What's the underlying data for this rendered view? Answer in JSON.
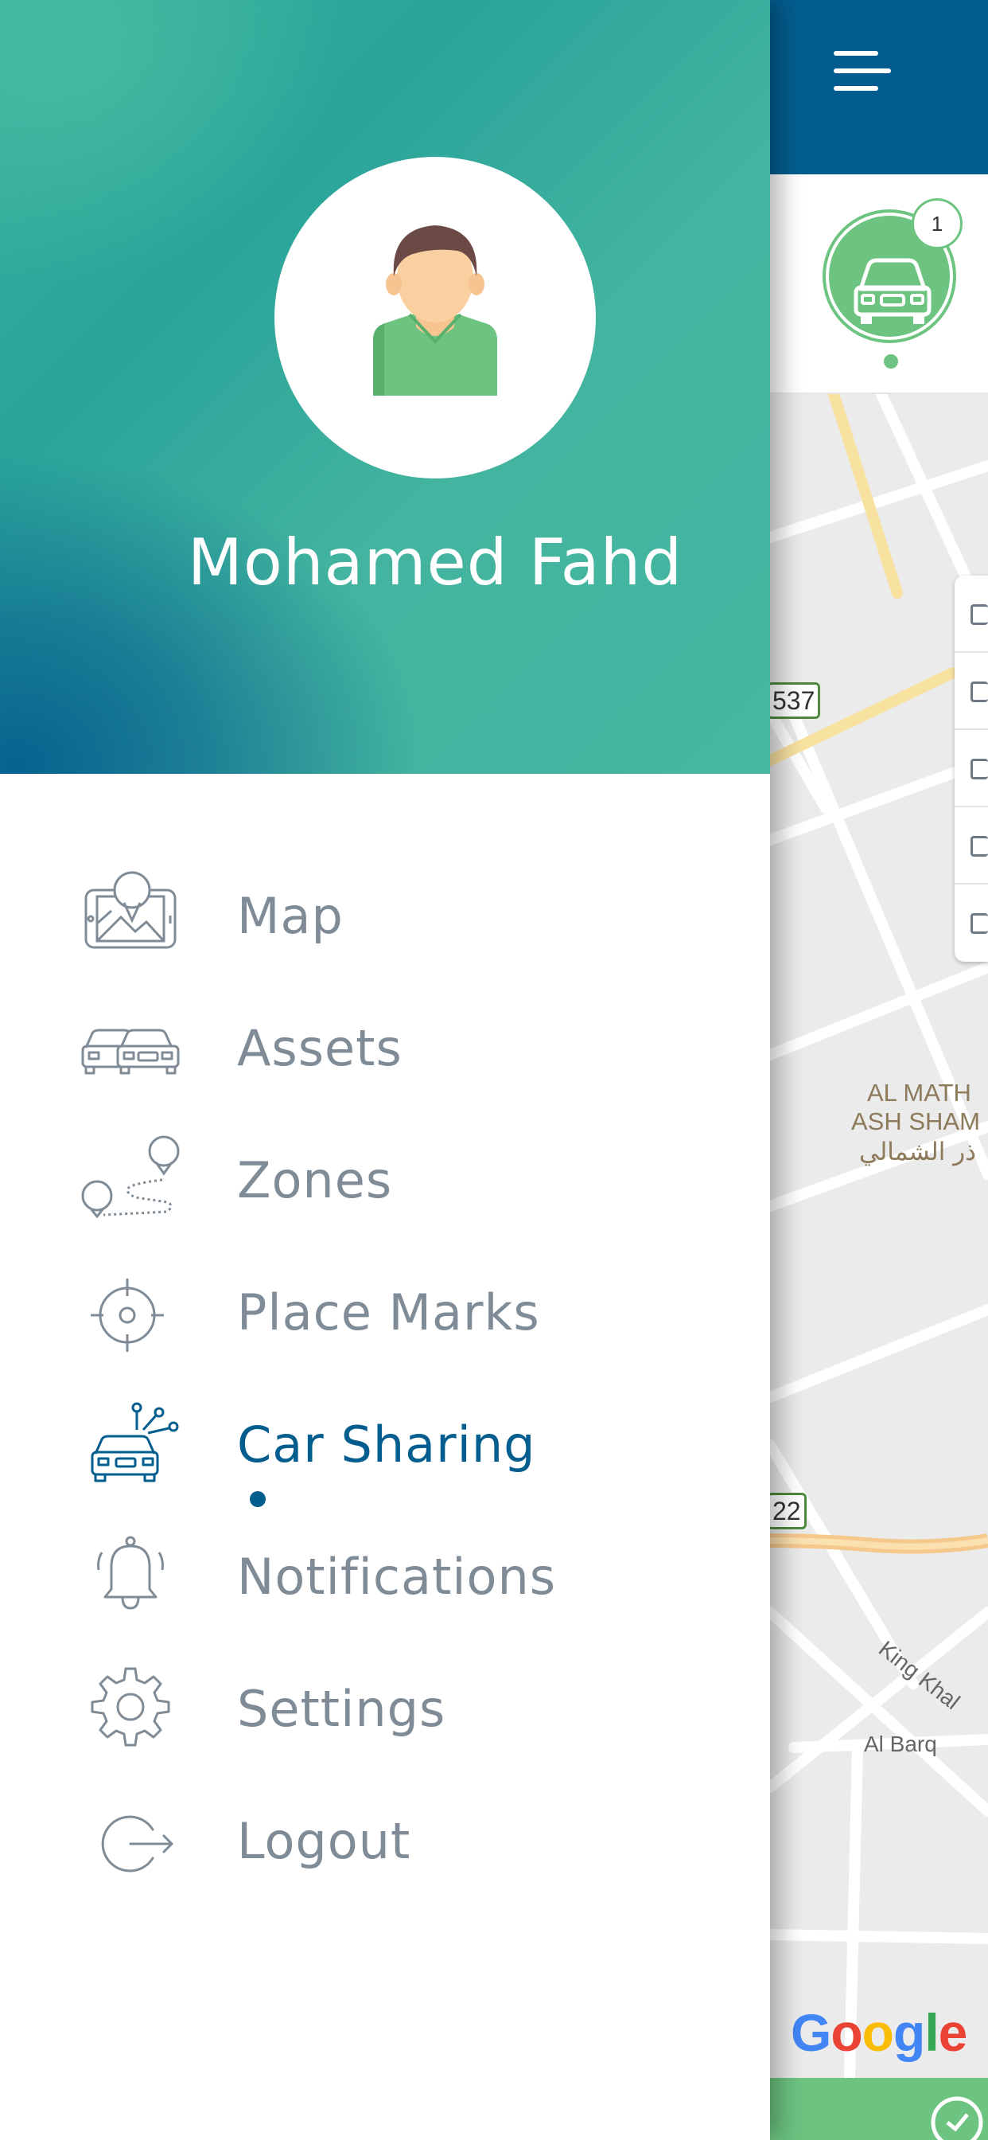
{
  "user": {
    "name": "Mohamed Fahd"
  },
  "menu": {
    "items": [
      {
        "id": "map",
        "label": "Map",
        "icon": "map-icon"
      },
      {
        "id": "assets",
        "label": "Assets",
        "icon": "cars-icon"
      },
      {
        "id": "zones",
        "label": "Zones",
        "icon": "zones-route-icon"
      },
      {
        "id": "place-marks",
        "label": "Place Marks",
        "icon": "target-icon"
      },
      {
        "id": "car-sharing",
        "label": "Car Sharing",
        "icon": "car-sharing-icon",
        "active": true
      },
      {
        "id": "notifications",
        "label": "Notifications",
        "icon": "bell-icon"
      },
      {
        "id": "settings",
        "label": "Settings",
        "icon": "gear-icon"
      },
      {
        "id": "logout",
        "label": "Logout",
        "icon": "logout-icon"
      }
    ]
  },
  "background_app": {
    "asset_badge_count": "1",
    "map_labels": {
      "route_537": "537",
      "route_22": "22",
      "district_en_1": "AL MATH",
      "district_en_2": "ASH SHAM",
      "district_ar": "ذر الشمالي",
      "road_king_khalid": "King Khal",
      "road_al_barq": "Al Barq"
    },
    "map_attribution": "Google"
  },
  "colors": {
    "primary_blue": "#035E8F",
    "header_teal": "#45B6A0",
    "accent_green": "#6CC480",
    "menu_text": "#7F8B96"
  }
}
